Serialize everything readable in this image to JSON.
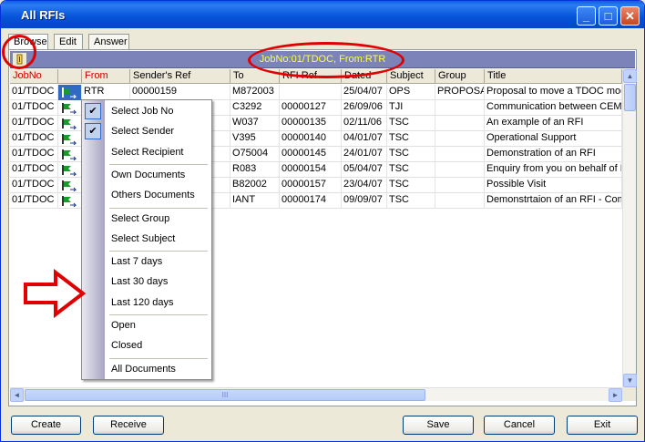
{
  "window": {
    "title": "All RFIs"
  },
  "titlebar_buttons": {
    "minimize": "_",
    "maximize": "□",
    "close": "✕"
  },
  "tabs": [
    {
      "label": "Browse"
    },
    {
      "label": "Edit"
    },
    {
      "label": "Answer"
    }
  ],
  "filter": {
    "text": "JobNo:01/TDOC, From:RTR"
  },
  "columns": [
    {
      "label": "JobNo",
      "highlighted": true
    },
    {
      "label": "",
      "highlighted": false
    },
    {
      "label": "From",
      "highlighted": true
    },
    {
      "label": "Sender's Ref",
      "highlighted": false
    },
    {
      "label": "To",
      "highlighted": false
    },
    {
      "label": "RFI Ref",
      "highlighted": false
    },
    {
      "label": "Dated",
      "highlighted": false
    },
    {
      "label": "Subject",
      "highlighted": false
    },
    {
      "label": "Group",
      "highlighted": false
    },
    {
      "label": "Title",
      "highlighted": false
    }
  ],
  "rows": [
    {
      "jobno": "01/TDOC",
      "selected": true,
      "from": "RTR",
      "senders_ref": "00000159",
      "to": "M872003",
      "rfi_ref": "",
      "dated": "25/04/07",
      "subject": "OPS",
      "group": "PROPOSA",
      "title": "Proposal to move a TDOC mod"
    },
    {
      "jobno": "01/TDOC",
      "selected": false,
      "from": "",
      "senders_ref": "",
      "to": "C3292",
      "rfi_ref": "00000127",
      "dated": "26/09/06",
      "subject": "TJI",
      "group": "",
      "title": "Communication between CEMD"
    },
    {
      "jobno": "01/TDOC",
      "selected": false,
      "from": "",
      "senders_ref": "",
      "to": "W037",
      "rfi_ref": "00000135",
      "dated": "02/11/06",
      "subject": "TSC",
      "group": "",
      "title": "An example of an RFI"
    },
    {
      "jobno": "01/TDOC",
      "selected": false,
      "from": "",
      "senders_ref": "",
      "to": "V395",
      "rfi_ref": "00000140",
      "dated": "04/01/07",
      "subject": "TSC",
      "group": "",
      "title": "Operational Support"
    },
    {
      "jobno": "01/TDOC",
      "selected": false,
      "from": "",
      "senders_ref": "",
      "to": "O75004",
      "rfi_ref": "00000145",
      "dated": "24/01/07",
      "subject": "TSC",
      "group": "",
      "title": "Demonstration of an RFI"
    },
    {
      "jobno": "01/TDOC",
      "selected": false,
      "from": "",
      "senders_ref": "",
      "to": "R083",
      "rfi_ref": "00000154",
      "dated": "05/04/07",
      "subject": "TSC",
      "group": "",
      "title": "Enquiry from you on behalf of E"
    },
    {
      "jobno": "01/TDOC",
      "selected": false,
      "from": "",
      "senders_ref": "",
      "to": "B82002",
      "rfi_ref": "00000157",
      "dated": "23/04/07",
      "subject": "TSC",
      "group": "",
      "title": "Possible Visit"
    },
    {
      "jobno": "01/TDOC",
      "selected": false,
      "from": "",
      "senders_ref": "",
      "to": "IANT",
      "rfi_ref": "00000174",
      "dated": "09/09/07",
      "subject": "TSC",
      "group": "",
      "title": "Demonstrtaion of an RFI - Com"
    }
  ],
  "context_menu": {
    "groups": [
      [
        {
          "label": "Select Job No",
          "checked": true
        },
        {
          "label": "Select Sender",
          "checked": true
        },
        {
          "label": "Select Recipient",
          "checked": false
        }
      ],
      [
        {
          "label": "Own Documents",
          "checked": false
        },
        {
          "label": "Others Documents",
          "checked": false
        }
      ],
      [
        {
          "label": "Select Group",
          "checked": false
        },
        {
          "label": "Select Subject",
          "checked": false
        }
      ],
      [
        {
          "label": "Last 7 days",
          "checked": false
        },
        {
          "label": "Last 30 days",
          "checked": false
        },
        {
          "label": "Last 120 days",
          "checked": false
        }
      ],
      [
        {
          "label": "Open",
          "checked": false
        },
        {
          "label": "Closed",
          "checked": false
        }
      ],
      [
        {
          "label": "All Documents",
          "checked": false
        }
      ]
    ]
  },
  "buttons": {
    "create": "Create",
    "receive": "Receive",
    "save": "Save",
    "cancel": "Cancel",
    "exit": "Exit"
  },
  "scroll_glyphs": {
    "up": "▲",
    "down": "▼",
    "left": "◄",
    "right": "►",
    "grip": "III"
  },
  "colors": {
    "title_blue": "#0552d8",
    "filter_bar": "#7b83b9",
    "filter_text": "#ffff40",
    "header_red": "#d00000",
    "annotation_red": "#e00000"
  }
}
